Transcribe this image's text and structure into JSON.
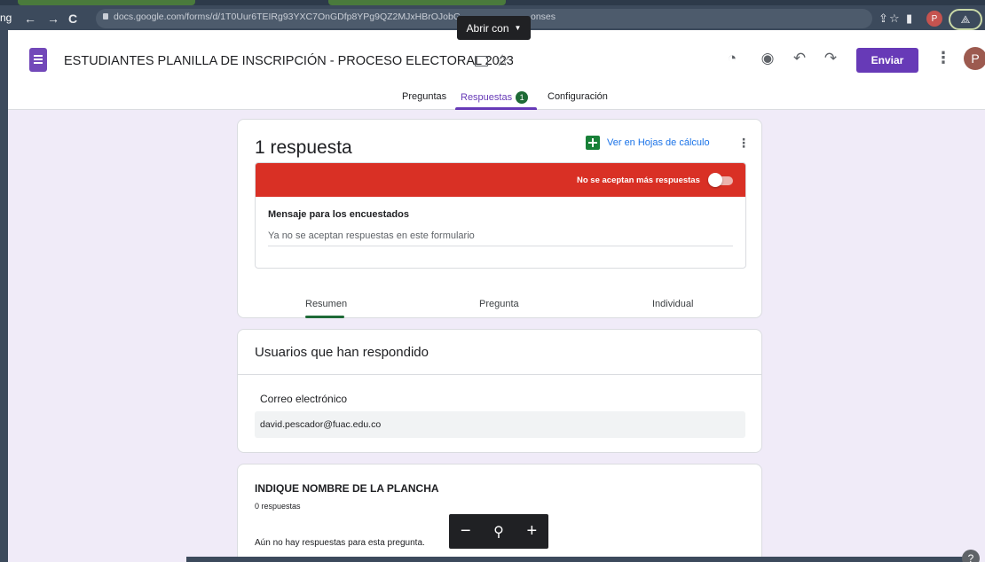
{
  "browser": {
    "left_fragment": "ng",
    "back": "←",
    "forward": "→",
    "reload": "C",
    "url": "docs.google.com/forms/d/1T0Uur6TEIRg93YXC7OnGDfp8YPg9QZ2MJxHBrOJobG",
    "url_tail": "onses",
    "open_with_label": "Abrir con",
    "profile_initial": "P"
  },
  "header": {
    "doc_title": "ESTUDIANTES  PLANILLA DE INSCRIPCIÓN - PROCESO ELECTORAL 2023",
    "send_label": "Enviar",
    "avatar_initial": "P"
  },
  "tabs": {
    "questions": "Preguntas",
    "responses": "Respuestas",
    "responses_badge": "1",
    "settings": "Configuración"
  },
  "summary_card": {
    "count_title": "1 respuesta",
    "sheets_link": "Ver en Hojas de cálculo",
    "not_accepting": "No se aceptan más respuestas",
    "message_label": "Mensaje para los encuestados",
    "message_value": "Ya no se aceptan respuestas en este formulario",
    "subtabs": [
      "Resumen",
      "Pregunta",
      "Individual"
    ]
  },
  "respondents_card": {
    "title": "Usuarios que han respondido",
    "email_label": "Correo electrónico",
    "emails": [
      "david.pescador@fuac.edu.co"
    ]
  },
  "question_card": {
    "title": "INDIQUE NOMBRE DE LA PLANCHA",
    "count": "0 respuestas",
    "empty_text": "Aún no hay respuestas para esta pregunta."
  },
  "zoom": {
    "minus": "−",
    "plus": "+"
  },
  "colors": {
    "accent": "#673ab7",
    "closed": "#d93025",
    "sheets": "#188038",
    "badge": "#1e6a36"
  }
}
